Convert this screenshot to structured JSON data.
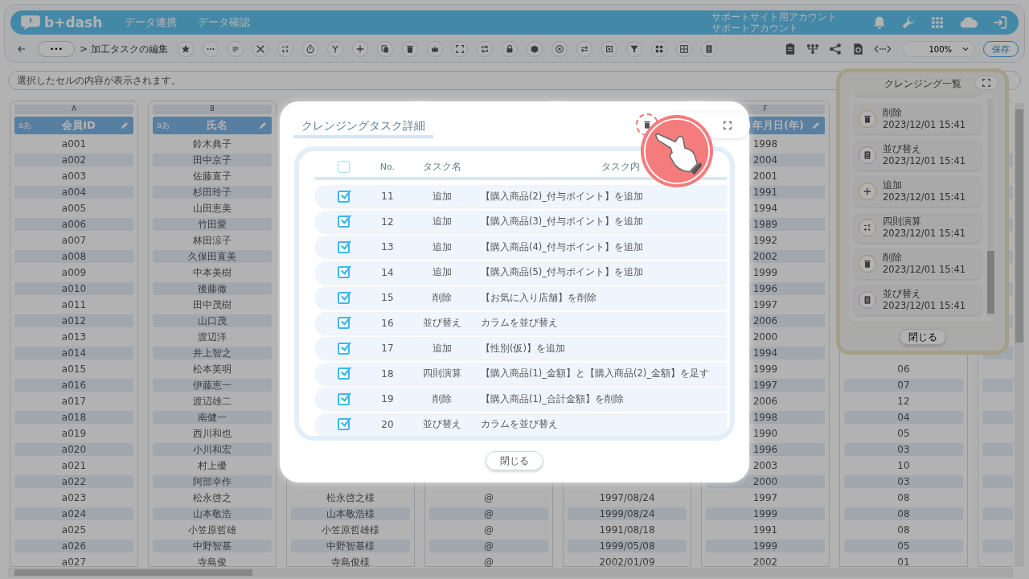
{
  "header": {
    "logo": "b+dash",
    "nav": [
      {
        "label": "データ連携"
      },
      {
        "label": "データ確認"
      }
    ],
    "account": {
      "site": "サポートサイト用アカウント",
      "name": "サポートアカウント"
    }
  },
  "toolbar": {
    "more": "•••",
    "breadcrumb": "> 加工タスクの編集",
    "zoom": "100%",
    "save": "保存"
  },
  "formula_bar": {
    "placeholder": "選択したセルの内容が表示されます。"
  },
  "sheet": {
    "columns": [
      {
        "letter": "A",
        "type_label": "aあ",
        "title": "会員ID",
        "cells": [
          "a001",
          "a002",
          "a003",
          "a004",
          "a005",
          "a006",
          "a007",
          "a008",
          "a009",
          "a010",
          "a011",
          "a012",
          "a013",
          "a014",
          "a015",
          "a016",
          "a017",
          "a018",
          "a019",
          "a020",
          "a021",
          "a022",
          "a023",
          "a024",
          "a025",
          "a026",
          "a027"
        ]
      },
      {
        "letter": "B",
        "type_label": "aあ",
        "title": "氏名",
        "cells": [
          "鈴木典子",
          "田中京子",
          "佐藤直子",
          "杉田玲子",
          "山田恵美",
          "竹田愛",
          "林田涼子",
          "久保田直美",
          "中本美樹",
          "後藤徹",
          "田中茂樹",
          "山口茂",
          "渡辺洋",
          "井上智之",
          "松本英明",
          "伊藤恵一",
          "渡辺雄二",
          "南健一",
          "西川和也",
          "小川和宏",
          "村上優",
          "阿部幸作",
          "松永啓之",
          "山本敬浩",
          "小笠原哲雄",
          "中野智基",
          "寺島俊"
        ]
      },
      {
        "cells": [
          "松永啓之様",
          "山本敬浩様",
          "小笠原哲雄様",
          "中野智基様",
          "寺島俊様"
        ]
      },
      {
        "cells": [
          "@",
          "@",
          "@",
          "@",
          "@"
        ]
      },
      {
        "cells": [
          "1997/08/24",
          "1999/08/24",
          "1991/08/18",
          "1999/05/08",
          "2002/01/09"
        ]
      },
      {
        "letter": "F",
        "title": "年月日(年)",
        "cells": [
          "1998",
          "2004",
          "2001",
          "1991",
          "1994",
          "1989",
          "1992",
          "2002",
          "1999",
          "1996",
          "1997",
          "2006",
          "2000",
          "1994",
          "1999",
          "1997",
          "2006",
          "1998",
          "1990",
          "1996",
          "2003",
          "2000",
          "1997",
          "1999",
          "1991",
          "1999",
          "2002"
        ]
      },
      {
        "cells": [
          "06",
          "07",
          "12",
          "04",
          "05",
          "03",
          "10",
          "03",
          "08",
          "08",
          "08",
          "05",
          "01"
        ]
      }
    ]
  },
  "cleansing_panel": {
    "title": "クレンジング一覧",
    "items": [
      {
        "kind": "delete",
        "name": "削除",
        "time": "2023/12/01 15:41"
      },
      {
        "kind": "sort",
        "name": "並び替え",
        "time": "2023/12/01 15:41"
      },
      {
        "kind": "add",
        "name": "追加",
        "time": "2023/12/01 15:41"
      },
      {
        "kind": "arithmetic",
        "name": "四則演算",
        "time": "2023/12/01 15:41"
      },
      {
        "kind": "delete",
        "name": "削除",
        "time": "2023/12/01 15:41"
      },
      {
        "kind": "sort",
        "name": "並び替え",
        "time": "2023/12/01 15:41"
      }
    ],
    "close": "閉じる"
  },
  "modal": {
    "title": "クレンジングタスク詳細",
    "trash_highlighted": true,
    "select_all_checked": false,
    "columns": [
      "No.",
      "タスク名",
      "タスク内"
    ],
    "rows": [
      {
        "checked": true,
        "no": "11",
        "name": "追加",
        "content": "【購入商品(2)_付与ポイント】を追加"
      },
      {
        "checked": true,
        "no": "12",
        "name": "追加",
        "content": "【購入商品(3)_付与ポイント】を追加"
      },
      {
        "checked": true,
        "no": "13",
        "name": "追加",
        "content": "【購入商品(4)_付与ポイント】を追加"
      },
      {
        "checked": true,
        "no": "14",
        "name": "追加",
        "content": "【購入商品(5)_付与ポイント】を追加"
      },
      {
        "checked": true,
        "no": "15",
        "name": "削除",
        "content": "【お気に入り店舗】を削除"
      },
      {
        "checked": true,
        "no": "16",
        "name": "並び替え",
        "content": "カラムを並び替え"
      },
      {
        "checked": true,
        "no": "17",
        "name": "追加",
        "content": "【性別(仮)】を追加"
      },
      {
        "checked": true,
        "no": "18",
        "name": "四則演算",
        "content": "【購入商品(1)_金額】と【購入商品(2)_金額】を足す"
      },
      {
        "checked": true,
        "no": "19",
        "name": "削除",
        "content": "【購入商品(1)_合計金額】を削除"
      },
      {
        "checked": true,
        "no": "20",
        "name": "並び替え",
        "content": "カラムを並び替え"
      }
    ],
    "close": "閉じる"
  }
}
